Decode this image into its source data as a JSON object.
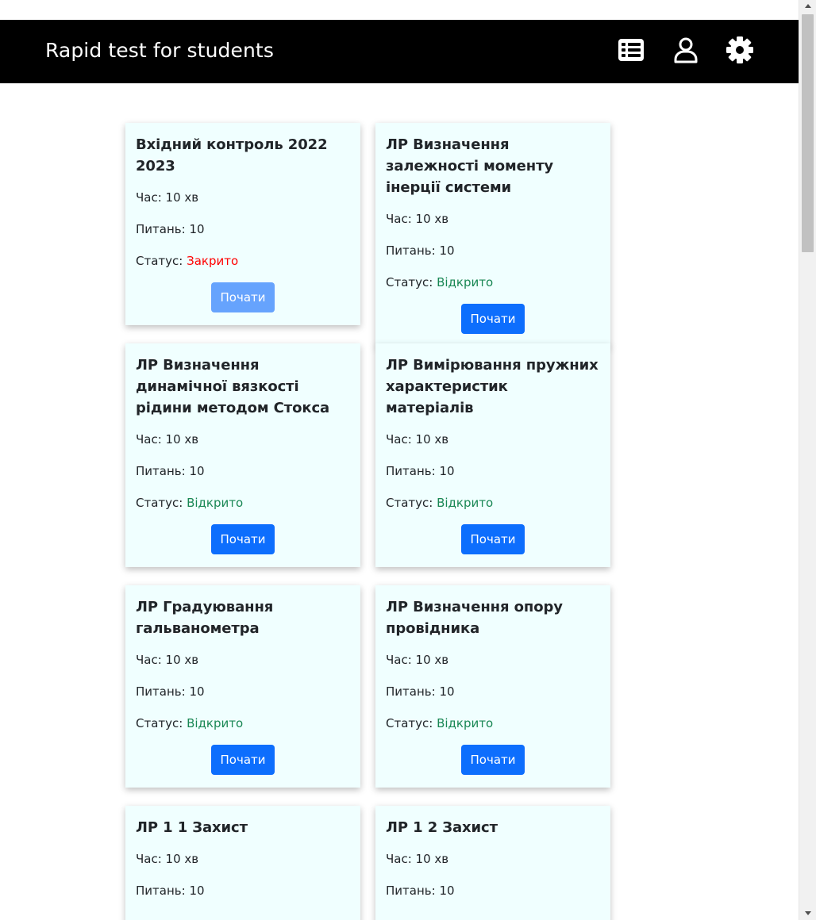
{
  "navbar": {
    "brand": "Rapid test for students",
    "icons": [
      "table-icon",
      "user-icon",
      "gear-icon"
    ]
  },
  "labels": {
    "time_prefix": "Час: ",
    "questions_prefix": "Питань: ",
    "status_prefix": "Статус: ",
    "start_button": "Почати"
  },
  "colors": {
    "navbar_bg": "#000000",
    "card_bg": "#f0ffff",
    "button": "#0d6efd",
    "button_disabled": "#66a3fd",
    "status_closed": "#ff0000",
    "status_open": "#198754"
  },
  "tests": [
    {
      "title": "Вхідний контроль 2022 2023",
      "time": "10 хв",
      "questions": "10",
      "status": "Закрито",
      "status_type": "closed",
      "button": "Почати",
      "disabled": true
    },
    {
      "title": "ЛР Визначення залежності моменту інерції системи",
      "time": "10 хв",
      "questions": "10",
      "status": "Відкрито",
      "status_type": "open",
      "button": "Почати",
      "disabled": false
    },
    {
      "title": "ЛР Визначення динамічної вязкості рідини методом Стокса",
      "time": "10 хв",
      "questions": "10",
      "status": "Відкрито",
      "status_type": "open",
      "button": "Почати",
      "disabled": false
    },
    {
      "title": "ЛР Вимірювання пружних характеристик матеріалів",
      "time": "10 хв",
      "questions": "10",
      "status": "Відкрито",
      "status_type": "open",
      "button": "Почати",
      "disabled": false
    },
    {
      "title": "ЛР Градуювання гальванометра",
      "time": "10 хв",
      "questions": "10",
      "status": "Відкрито",
      "status_type": "open",
      "button": "Почати",
      "disabled": false
    },
    {
      "title": "ЛР Визначення опору провідника",
      "time": "10 хв",
      "questions": "10",
      "status": "Відкрито",
      "status_type": "open",
      "button": "Почати",
      "disabled": false
    },
    {
      "title": "ЛР 1 1 Захист",
      "time": "10 хв",
      "questions": "10"
    },
    {
      "title": "ЛР 1 2 Захист",
      "time": "10 хв",
      "questions": "10"
    }
  ]
}
